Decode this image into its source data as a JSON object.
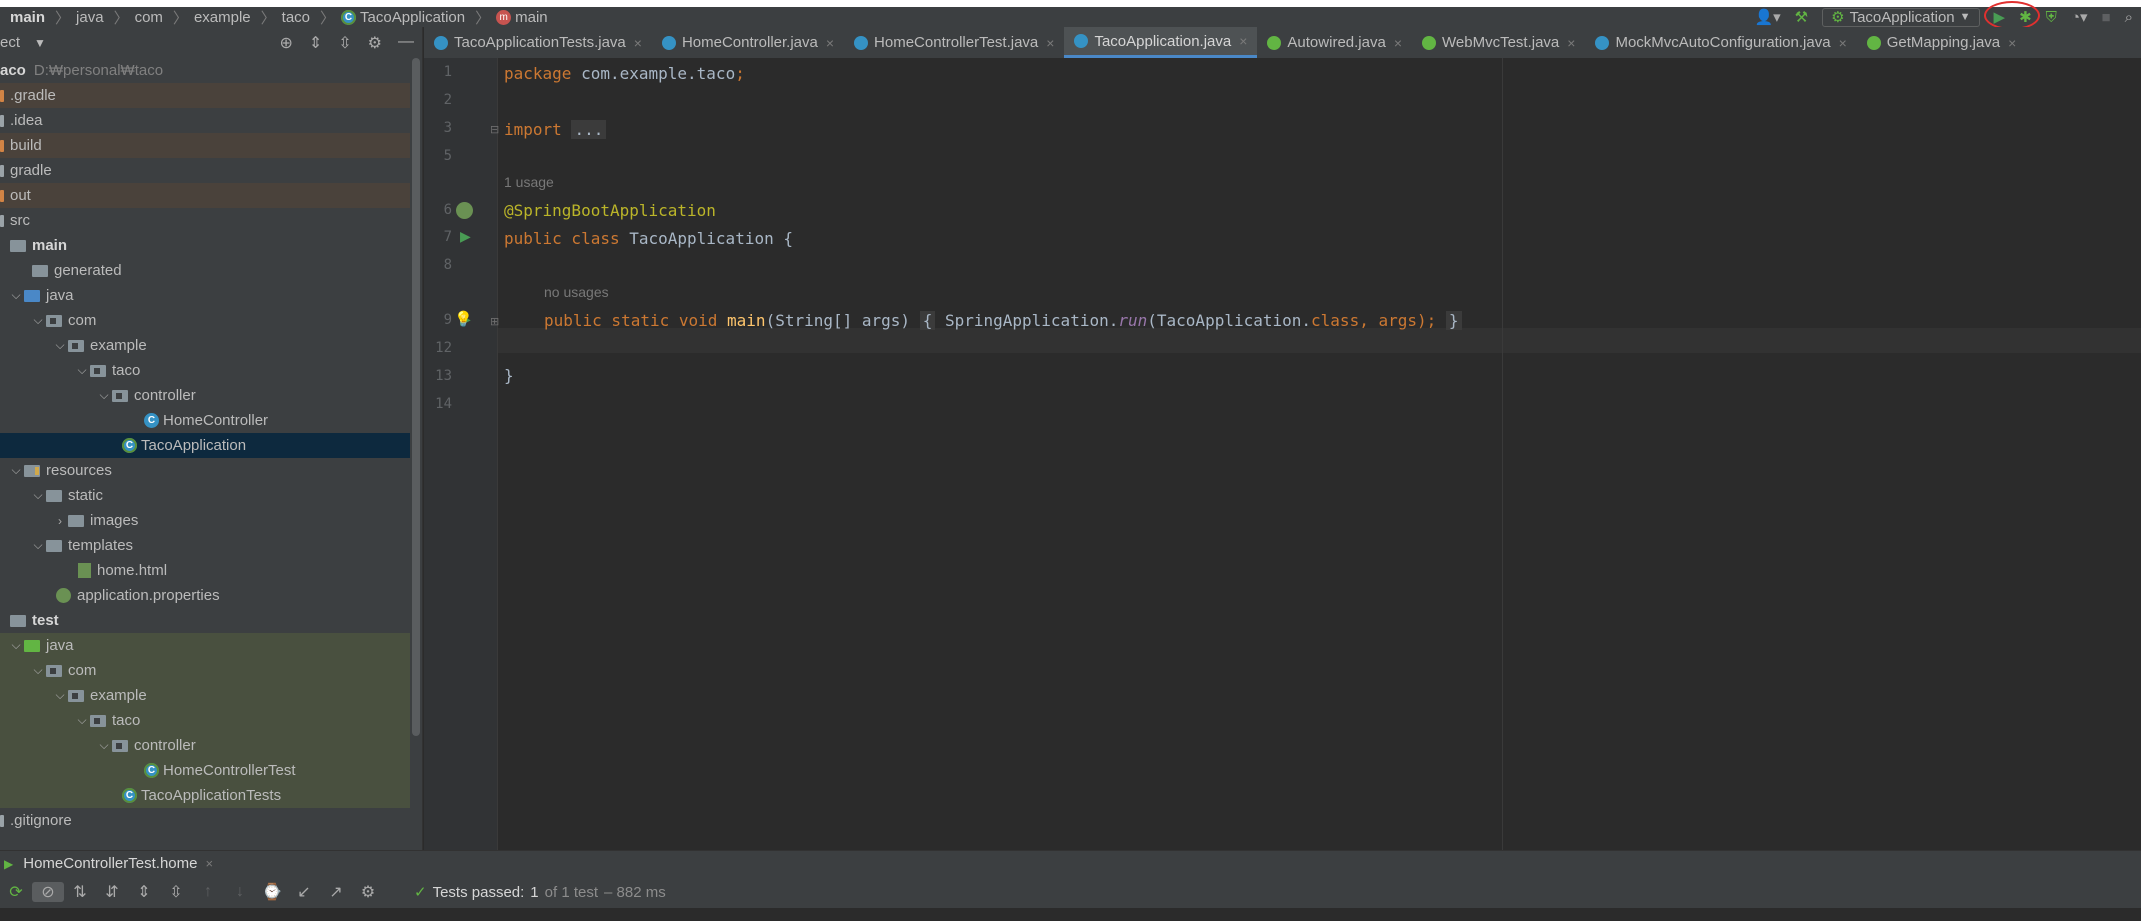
{
  "navbar": {
    "crumbs": [
      "main",
      "java",
      "com",
      "example",
      "taco",
      "TacoApplication",
      "main"
    ],
    "run_config": "TacoApplication"
  },
  "project": {
    "title": "ect",
    "root": {
      "name": "aco",
      "path": "D:₩personal₩taco"
    },
    "items": [
      ".gradle",
      ".idea",
      "build",
      "gradle",
      "out",
      "src",
      "main",
      "generated",
      "java",
      "com",
      "example",
      "taco",
      "controller",
      "HomeController",
      "TacoApplication",
      "resources",
      "static",
      "images",
      "templates",
      "home.html",
      "application.properties",
      "test",
      "java",
      "com",
      "example",
      "taco",
      "controller",
      "HomeControllerTest",
      "TacoApplicationTests",
      ".gitignore"
    ]
  },
  "tabs": [
    "TacoApplicationTests.java",
    "HomeController.java",
    "HomeControllerTest.java",
    "TacoApplication.java",
    "Autowired.java",
    "WebMvcTest.java",
    "MockMvcAutoConfiguration.java",
    "GetMapping.java"
  ],
  "code": {
    "line_numbers": [
      "1",
      "2",
      "3",
      "5",
      "6",
      "7",
      "8",
      "9",
      "12",
      "13",
      "14"
    ],
    "package_kw": "package",
    "package_name": " com.example.taco",
    "semicolon": ";",
    "import_kw": "import",
    "import_fold": "...",
    "hint_usage": "1 usage",
    "annotation": "@SpringBootApplication",
    "class_public": "public",
    "class_kw": " class",
    "class_name": " TacoApplication {",
    "hint_no_usages": "no usages",
    "main_mods": "public static void",
    "main_name": " main",
    "main_params": "(String[] args) ",
    "open_brace": "{",
    "body_start": " SpringApplication.",
    "run_call": "run",
    "run_args_1": "(TacoApplication.",
    "class_lit": "class",
    "run_args_2": ", args); ",
    "close_brace": "}",
    "class_close": "}"
  },
  "bottom": {
    "run_tab": "HomeControllerTest.home",
    "tests_passed": "Tests passed:",
    "passed_count": "1",
    "of_total": "of 1 test",
    "duration": "– 882 ms"
  }
}
